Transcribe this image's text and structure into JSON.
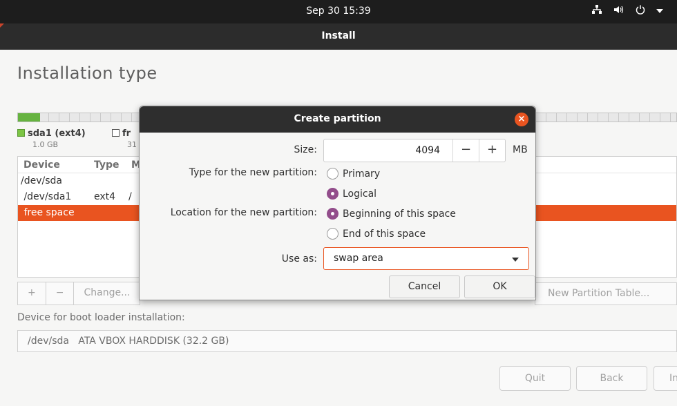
{
  "topbar": {
    "datetime": "Sep 30  15:39",
    "icons": [
      "network-icon",
      "volume-icon",
      "power-icon",
      "chevron-down-icon"
    ]
  },
  "window": {
    "title": "Install"
  },
  "page": {
    "title": "Installation type"
  },
  "partitions": {
    "legend": [
      {
        "name": "sda1 (ext4)",
        "size": "1.0 GB"
      },
      {
        "name": "fr",
        "size": "31"
      }
    ]
  },
  "device_table": {
    "columns": [
      "Device",
      "Type",
      "M"
    ],
    "rows": [
      {
        "device": "/dev/sda",
        "type": "",
        "mount": ""
      },
      {
        "device": " /dev/sda1",
        "type": "ext4",
        "mount": "/"
      },
      {
        "device": " free space",
        "type": "",
        "mount": ""
      }
    ],
    "selected_index": 2
  },
  "table_buttons": {
    "add": "+",
    "remove": "−",
    "change": "Change..."
  },
  "new_partition_table": "New Partition Table...",
  "boot_loader": {
    "label": "Device for boot loader installation:",
    "value": "/dev/sda   ATA VBOX HARDDISK (32.2 GB)"
  },
  "bottom_buttons": {
    "quit": "Quit",
    "back": "Back",
    "install": "In"
  },
  "dialog": {
    "title": "Create partition",
    "size_label": "Size:",
    "size_value": "4094",
    "size_unit": "MB",
    "decrement": "−",
    "increment": "+",
    "type_label": "Type for the new partition:",
    "type_options": [
      "Primary",
      "Logical"
    ],
    "type_selected": "Logical",
    "location_label": "Location for the new partition:",
    "location_options": [
      "Beginning of this space",
      "End of this space"
    ],
    "location_selected": "Beginning of this space",
    "use_as_label": "Use as:",
    "use_as_value": "swap area",
    "cancel": "Cancel",
    "ok": "OK"
  },
  "colors": {
    "accent": "#e95420",
    "radio_selected": "#924d8b",
    "used_space": "#66b340"
  }
}
